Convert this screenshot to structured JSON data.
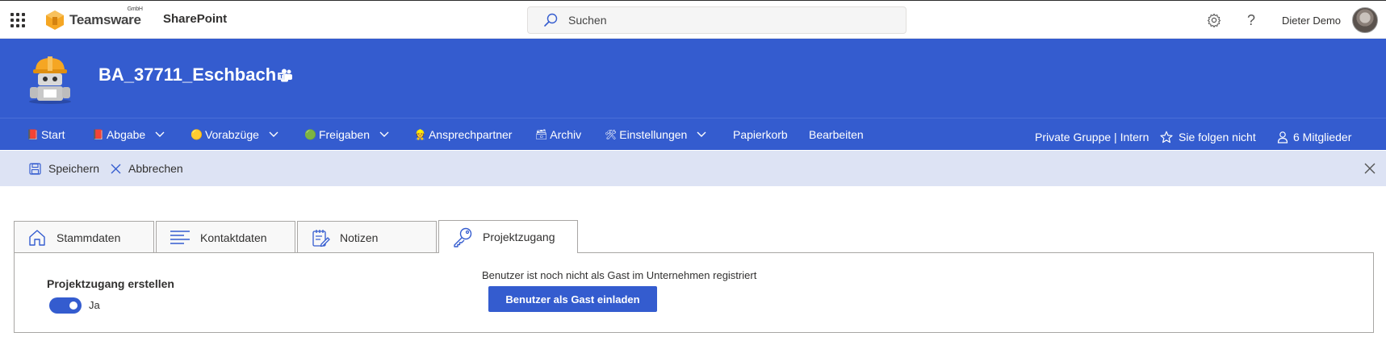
{
  "suitebar": {
    "brand": "Teamsware",
    "brand_suffix": "GmbH",
    "app": "SharePoint",
    "search_placeholder": "Suchen",
    "settings_icon": "gear-icon",
    "help": "?",
    "user": "Dieter Demo"
  },
  "site": {
    "title": "BA_37711_Eschbach"
  },
  "nav": {
    "items": [
      {
        "label": "Start",
        "emoji": "📕"
      },
      {
        "label": "Abgabe",
        "emoji": "📕"
      },
      {
        "label": "Vorabzüge",
        "emoji": "🟡"
      },
      {
        "label": "Freigaben",
        "emoji": "🟢"
      },
      {
        "label": "Ansprechpartner",
        "emoji": "👷"
      },
      {
        "label": "Archiv",
        "emoji": "🗃"
      },
      {
        "label": "Einstellungen",
        "emoji": "🛠"
      },
      {
        "label": "Papierkorb"
      },
      {
        "label": "Bearbeiten"
      }
    ],
    "group_info": "Private Gruppe | Intern",
    "follow": "Sie folgen nicht",
    "members": "6 Mitglieder"
  },
  "command": {
    "save": "Speichern",
    "cancel": "Abbrechen"
  },
  "tabs": [
    {
      "label": "Stammdaten"
    },
    {
      "label": "Kontaktdaten"
    },
    {
      "label": "Notizen"
    },
    {
      "label": "Projektzugang"
    }
  ],
  "panel": {
    "field_label": "Projektzugang erstellen",
    "toggle_text": "Ja",
    "toggle_on": true,
    "info": "Benutzer ist noch nicht als Gast im Unternehmen registriert",
    "button": "Benutzer als Gast einladen"
  },
  "colors": {
    "brand_blue": "#345ccf",
    "command_bar": "#dde3f4"
  }
}
